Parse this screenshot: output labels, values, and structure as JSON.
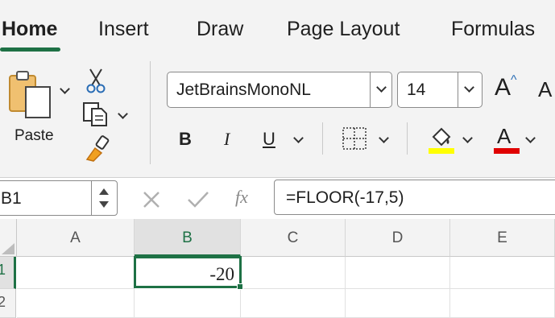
{
  "tabs": [
    {
      "label": "Home",
      "active": true
    },
    {
      "label": "Insert",
      "active": false
    },
    {
      "label": "Draw",
      "active": false
    },
    {
      "label": "Page Layout",
      "active": false
    },
    {
      "label": "Formulas",
      "active": false
    }
  ],
  "ribbon": {
    "paste_label": "Paste",
    "font_name": "JetBrainsMonoNL",
    "font_size": "14",
    "bold_label": "B",
    "italic_label": "I",
    "underline_label": "U",
    "font_color_label": "A",
    "increase_font_label": "A",
    "decrease_font_label": "A",
    "fill_color": "#ffff00",
    "font_color": "#e00000"
  },
  "formula_bar": {
    "name_box": "B1",
    "fx_label": "fx",
    "formula": "=FLOOR(-17,5)"
  },
  "grid": {
    "columns": [
      "A",
      "B",
      "C",
      "D",
      "E"
    ],
    "rows": [
      "1",
      "2"
    ],
    "active_cell": "B1",
    "cells": {
      "B1": "-20"
    }
  },
  "colors": {
    "accent": "#1e7145"
  }
}
